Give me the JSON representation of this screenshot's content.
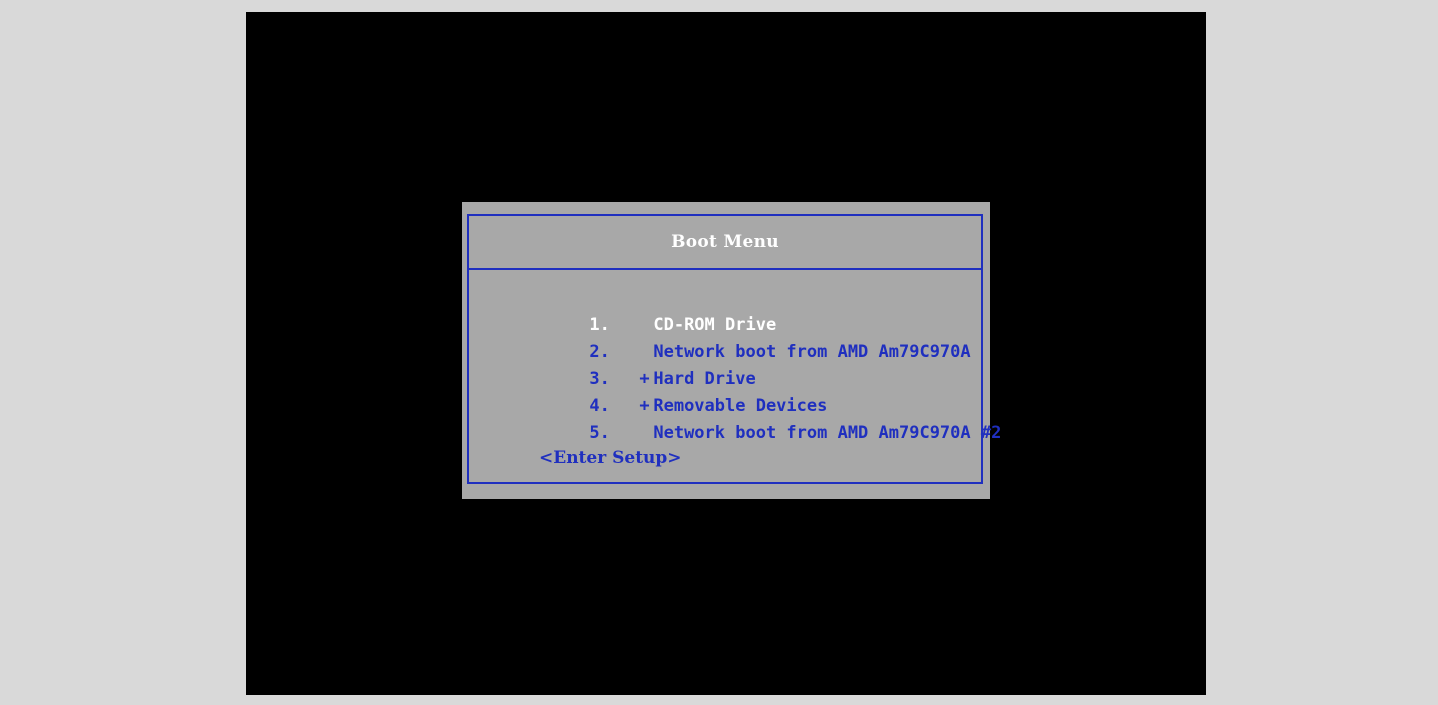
{
  "boot_menu": {
    "title": "Boot Menu",
    "items": [
      {
        "number": "1.",
        "prefix": "",
        "label": "CD-ROM Drive",
        "selected": true
      },
      {
        "number": "2.",
        "prefix": "",
        "label": "Network boot from AMD Am79C970A",
        "selected": false
      },
      {
        "number": "3.",
        "prefix": "+",
        "label": "Hard Drive",
        "selected": false
      },
      {
        "number": "4.",
        "prefix": "+",
        "label": "Removable Devices",
        "selected": false
      },
      {
        "number": "5.",
        "prefix": "",
        "label": "Network boot from AMD Am79C970A #2",
        "selected": false
      }
    ],
    "enter_setup": "<Enter Setup>"
  },
  "colors": {
    "screen_background": "#000000",
    "menu_background": "#a8a8a8",
    "menu_text": "#1f2fbf",
    "selected_text": "#ffffff",
    "outer_background": "#d9d9d9"
  }
}
